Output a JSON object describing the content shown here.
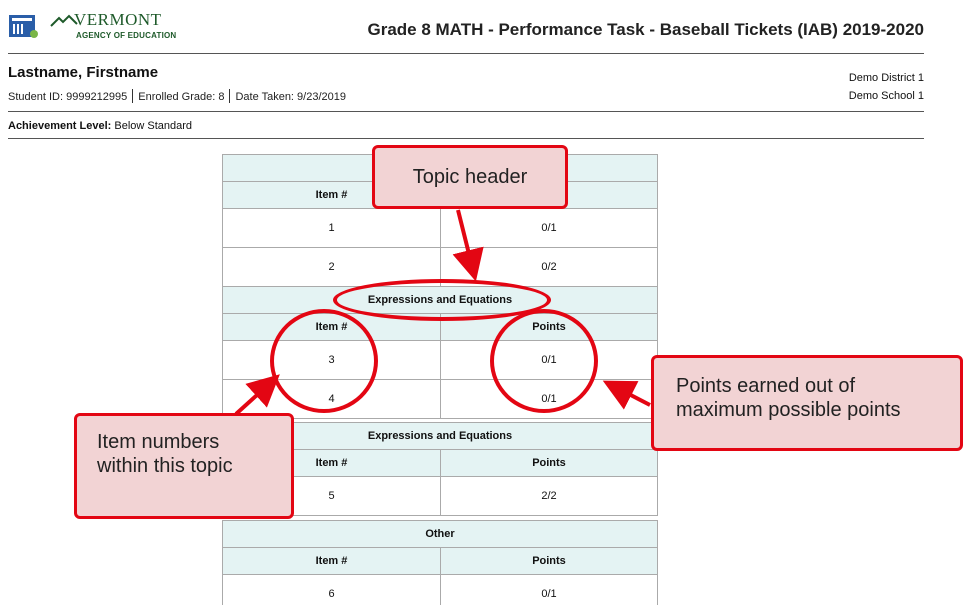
{
  "header": {
    "logo_name": "VERMONT",
    "logo_sub": "AGENCY OF EDUCATION",
    "report_title": "Grade 8 MATH - Performance Task - Baseball Tickets (IAB) 2019-2020"
  },
  "student": {
    "name": "Lastname, Firstname",
    "id_text": "Student ID: 9999212995",
    "grade_text": "Enrolled Grade: 8",
    "date_text": "Date Taken: 9/23/2019",
    "district": "Demo District 1",
    "school": "Demo School 1"
  },
  "achievement": {
    "label": "Achievement Level:",
    "value": "Below Standard"
  },
  "columns": {
    "item": "Item #",
    "points": "Points"
  },
  "topics": [
    {
      "title": "",
      "rows": [
        {
          "item": "1",
          "points": "0/1"
        },
        {
          "item": "2",
          "points": "0/2"
        }
      ]
    },
    {
      "title": "Expressions and Equations",
      "rows": [
        {
          "item": "3",
          "points": "0/1"
        },
        {
          "item": "4",
          "points": "0/1"
        }
      ]
    },
    {
      "title": "Expressions and Equations",
      "rows": [
        {
          "item": "5",
          "points": "2/2"
        }
      ]
    },
    {
      "title": "Other",
      "rows": [
        {
          "item": "6",
          "points": "0/1"
        }
      ]
    }
  ],
  "annotations": {
    "topic_header": "Topic header",
    "item_numbers_line1": "Item numbers",
    "item_numbers_line2": "within this topic",
    "points_line1": "Points earned out of",
    "points_line2": "maximum possible points"
  },
  "colors": {
    "annotation_red": "#e30613",
    "callout_fill": "#f2d3d4",
    "table_header_fill": "#e4f3f3",
    "logo_green": "#1e5a2a"
  }
}
